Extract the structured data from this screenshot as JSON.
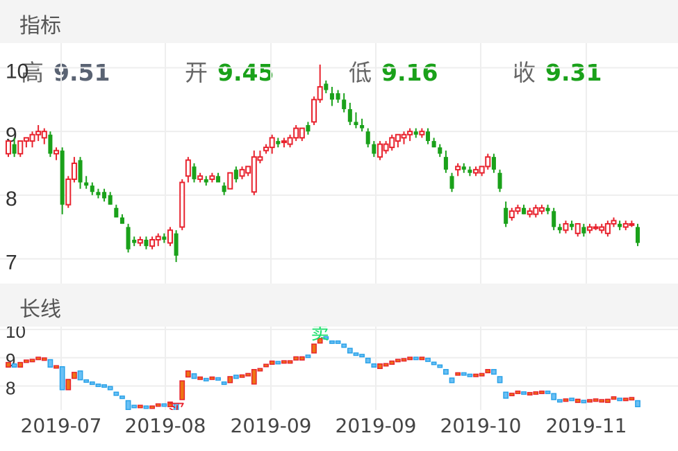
{
  "sections": {
    "indicator_title": "指标",
    "longline_title": "长线"
  },
  "ohlc": {
    "high": {
      "label": "高",
      "value": "9.51"
    },
    "open": {
      "label": "开",
      "value": "9.45"
    },
    "low": {
      "label": "低",
      "value": "9.16"
    },
    "close": {
      "label": "收",
      "value": "9.31"
    }
  },
  "colors": {
    "up": "#e8232e",
    "down": "#1aa11a",
    "grid": "#eeeeee",
    "line_blue": "#2aa2e8",
    "sell_text": "#19e06a",
    "buy_text": "#e8232e",
    "neutral_value": "#5a6373"
  },
  "signals": {
    "buy": "买",
    "sell": "卖"
  },
  "chart_data": [
    {
      "type": "candlestick",
      "title": "",
      "ylim": [
        6.7,
        10.3
      ],
      "y_ticks": [
        "10",
        "9",
        "8",
        "7"
      ],
      "grid": true,
      "candles_ohlc_open_high_low_close": [
        [
          8.65,
          8.85,
          8.6,
          8.85
        ],
        [
          8.8,
          8.9,
          8.6,
          8.65
        ],
        [
          8.65,
          8.85,
          8.6,
          8.85
        ],
        [
          8.85,
          8.9,
          8.75,
          8.9
        ],
        [
          8.85,
          9.0,
          8.75,
          8.95
        ],
        [
          8.95,
          9.1,
          8.85,
          9.0
        ],
        [
          8.9,
          9.05,
          8.8,
          9.0
        ],
        [
          8.95,
          9.0,
          8.6,
          8.65
        ],
        [
          8.65,
          8.75,
          8.55,
          8.7
        ],
        [
          8.7,
          8.75,
          7.7,
          7.85
        ],
        [
          7.85,
          8.3,
          7.8,
          8.25
        ],
        [
          8.25,
          8.6,
          8.2,
          8.5
        ],
        [
          8.55,
          8.6,
          8.1,
          8.2
        ],
        [
          8.2,
          8.3,
          8.1,
          8.15
        ],
        [
          8.15,
          8.2,
          8.0,
          8.05
        ],
        [
          8.05,
          8.1,
          7.95,
          8.0
        ],
        [
          8.05,
          8.1,
          7.9,
          7.95
        ],
        [
          8.0,
          8.05,
          7.85,
          7.85
        ],
        [
          7.8,
          7.85,
          7.65,
          7.65
        ],
        [
          7.65,
          7.7,
          7.55,
          7.55
        ],
        [
          7.5,
          7.55,
          7.1,
          7.15
        ],
        [
          7.3,
          7.35,
          7.2,
          7.25
        ],
        [
          7.25,
          7.35,
          7.2,
          7.3
        ],
        [
          7.3,
          7.35,
          7.15,
          7.2
        ],
        [
          7.2,
          7.35,
          7.15,
          7.3
        ],
        [
          7.3,
          7.4,
          7.2,
          7.35
        ],
        [
          7.35,
          7.4,
          7.25,
          7.3
        ],
        [
          7.25,
          7.5,
          7.2,
          7.45
        ],
        [
          7.4,
          7.45,
          6.95,
          7.05
        ],
        [
          7.5,
          8.25,
          7.45,
          8.2
        ],
        [
          8.3,
          8.6,
          8.2,
          8.55
        ],
        [
          8.45,
          8.5,
          8.2,
          8.25
        ],
        [
          8.25,
          8.35,
          8.2,
          8.3
        ],
        [
          8.25,
          8.3,
          8.15,
          8.2
        ],
        [
          8.25,
          8.35,
          8.2,
          8.3
        ],
        [
          8.3,
          8.35,
          8.2,
          8.2
        ],
        [
          8.15,
          8.2,
          8.0,
          8.05
        ],
        [
          8.1,
          8.35,
          8.1,
          8.35
        ],
        [
          8.4,
          8.45,
          8.2,
          8.25
        ],
        [
          8.3,
          8.45,
          8.25,
          8.4
        ],
        [
          8.35,
          8.45,
          8.3,
          8.45
        ],
        [
          8.05,
          8.7,
          8.0,
          8.6
        ],
        [
          8.55,
          8.7,
          8.5,
          8.6
        ],
        [
          8.7,
          8.8,
          8.65,
          8.75
        ],
        [
          8.75,
          8.95,
          8.65,
          8.9
        ],
        [
          8.85,
          8.9,
          8.75,
          8.8
        ],
        [
          8.85,
          8.9,
          8.75,
          8.85
        ],
        [
          8.8,
          8.95,
          8.75,
          8.9
        ],
        [
          8.9,
          9.1,
          8.85,
          9.05
        ],
        [
          8.9,
          9.05,
          8.85,
          9.05
        ],
        [
          9.1,
          9.15,
          8.95,
          9.0
        ],
        [
          9.15,
          9.55,
          9.1,
          9.5
        ],
        [
          9.5,
          10.05,
          9.45,
          9.7
        ],
        [
          9.75,
          9.8,
          9.6,
          9.65
        ],
        [
          9.6,
          9.7,
          9.4,
          9.5
        ],
        [
          9.6,
          9.65,
          9.45,
          9.5
        ],
        [
          9.5,
          9.6,
          9.3,
          9.35
        ],
        [
          9.35,
          9.45,
          9.1,
          9.15
        ],
        [
          9.15,
          9.3,
          9.05,
          9.1
        ],
        [
          9.1,
          9.2,
          9.0,
          9.05
        ],
        [
          9.0,
          9.05,
          8.75,
          8.8
        ],
        [
          8.8,
          8.85,
          8.6,
          8.65
        ],
        [
          8.6,
          8.85,
          8.55,
          8.8
        ],
        [
          8.7,
          8.85,
          8.65,
          8.8
        ],
        [
          8.75,
          8.95,
          8.7,
          8.9
        ],
        [
          8.85,
          8.95,
          8.75,
          8.95
        ],
        [
          8.9,
          9.0,
          8.8,
          8.95
        ],
        [
          8.95,
          9.05,
          8.85,
          9.0
        ],
        [
          9.0,
          9.05,
          8.9,
          8.95
        ],
        [
          8.95,
          9.05,
          8.9,
          9.0
        ],
        [
          9.0,
          9.05,
          8.8,
          8.85
        ],
        [
          8.85,
          8.9,
          8.75,
          8.75
        ],
        [
          8.75,
          8.8,
          8.6,
          8.65
        ],
        [
          8.6,
          8.7,
          8.35,
          8.4
        ],
        [
          8.3,
          8.35,
          8.05,
          8.1
        ],
        [
          8.4,
          8.5,
          8.3,
          8.45
        ],
        [
          8.45,
          8.5,
          8.35,
          8.4
        ],
        [
          8.4,
          8.45,
          8.3,
          8.35
        ],
        [
          8.35,
          8.45,
          8.3,
          8.4
        ],
        [
          8.35,
          8.45,
          8.3,
          8.45
        ],
        [
          8.45,
          8.65,
          8.4,
          8.6
        ],
        [
          8.6,
          8.65,
          8.35,
          8.4
        ],
        [
          8.35,
          8.4,
          8.05,
          8.1
        ],
        [
          7.8,
          7.9,
          7.5,
          7.55
        ],
        [
          7.65,
          7.8,
          7.6,
          7.75
        ],
        [
          7.75,
          7.85,
          7.7,
          7.8
        ],
        [
          7.8,
          7.85,
          7.7,
          7.7
        ],
        [
          7.7,
          7.8,
          7.65,
          7.75
        ],
        [
          7.7,
          7.85,
          7.65,
          7.8
        ],
        [
          7.75,
          7.85,
          7.7,
          7.8
        ],
        [
          7.8,
          7.85,
          7.7,
          7.75
        ],
        [
          7.75,
          7.8,
          7.45,
          7.5
        ],
        [
          7.5,
          7.55,
          7.4,
          7.45
        ],
        [
          7.45,
          7.6,
          7.4,
          7.55
        ],
        [
          7.55,
          7.6,
          7.45,
          7.5
        ],
        [
          7.4,
          7.55,
          7.35,
          7.55
        ],
        [
          7.5,
          7.55,
          7.35,
          7.4
        ],
        [
          7.45,
          7.55,
          7.4,
          7.5
        ],
        [
          7.5,
          7.55,
          7.45,
          7.5
        ],
        [
          7.45,
          7.55,
          7.4,
          7.5
        ],
        [
          7.4,
          7.6,
          7.35,
          7.55
        ],
        [
          7.55,
          7.65,
          7.5,
          7.6
        ],
        [
          7.55,
          7.6,
          7.45,
          7.5
        ],
        [
          7.5,
          7.6,
          7.45,
          7.55
        ],
        [
          7.55,
          7.6,
          7.5,
          7.55
        ],
        [
          7.5,
          7.55,
          7.2,
          7.25
        ]
      ]
    },
    {
      "type": "candlestick",
      "title": "",
      "ylim": [
        7.2,
        10.1
      ],
      "y_ticks": [
        "10",
        "9",
        "8"
      ],
      "x_ticks": [
        "2019-07",
        "2019-08",
        "2019-09",
        "2019-09",
        "2019-10",
        "2019-11"
      ],
      "annotations": [
        {
          "text": "买",
          "at_candle": 28
        },
        {
          "text": "卖",
          "at_candle": 52
        }
      ]
    }
  ]
}
